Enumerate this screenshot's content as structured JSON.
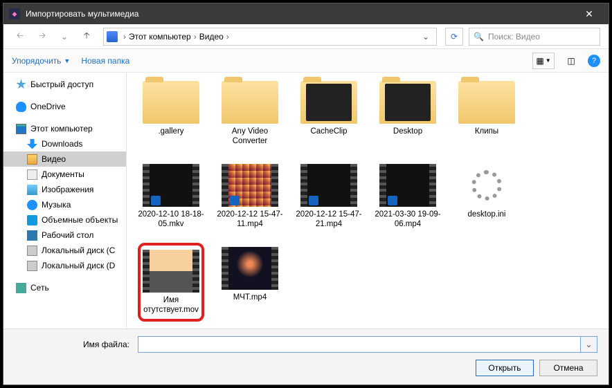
{
  "window": {
    "title": "Импортировать мультимедиа"
  },
  "breadcrumb": {
    "root": "Этот компьютер",
    "folder": "Видео"
  },
  "search": {
    "placeholder": "Поиск: Видео"
  },
  "toolbar": {
    "organize": "Упорядочить",
    "newfolder": "Новая папка"
  },
  "sidebar": {
    "quick": "Быстрый доступ",
    "onedrive": "OneDrive",
    "pc": "Этот компьютер",
    "downloads": "Downloads",
    "video": "Видео",
    "docs": "Документы",
    "images": "Изображения",
    "music": "Музыка",
    "objects3d": "Объемные объекты",
    "desktop": "Рабочий стол",
    "diskc": "Локальный диск (C",
    "diskd": "Локальный диск (D",
    "network": "Сеть"
  },
  "files": [
    {
      "name": ".gallery",
      "type": "folder"
    },
    {
      "name": "Any Video Converter",
      "type": "folder"
    },
    {
      "name": "CacheClip",
      "type": "folder-dark"
    },
    {
      "name": "Desktop",
      "type": "folder-dark"
    },
    {
      "name": "Клипы",
      "type": "folder"
    },
    {
      "name": "2020-12-10 18-18-05.mkv",
      "type": "video-black"
    },
    {
      "name": "2020-12-12 15-47-11.mp4",
      "type": "video-game"
    },
    {
      "name": "2020-12-12 15-47-21.mp4",
      "type": "video-black"
    },
    {
      "name": "2021-03-30 19-09-06.mp4",
      "type": "video-black"
    },
    {
      "name": "desktop.ini",
      "type": "gear"
    },
    {
      "name": "Имя отутствует.mov",
      "type": "video-sunset",
      "highlight": true
    },
    {
      "name": "МЧТ.mp4",
      "type": "video-stage"
    }
  ],
  "footer": {
    "filename_label": "Имя файла:",
    "filename_value": "",
    "open": "Открыть",
    "cancel": "Отмена"
  }
}
